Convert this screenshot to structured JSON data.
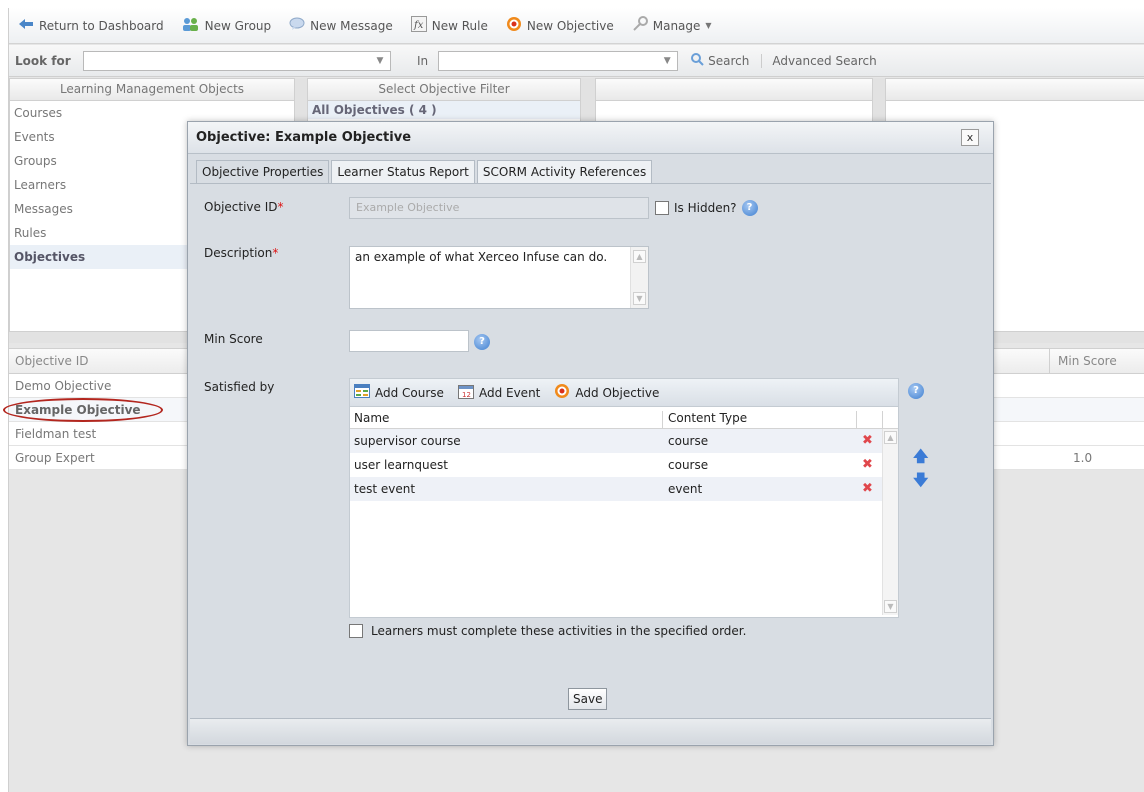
{
  "toolbar": {
    "return": "Return to Dashboard",
    "new_group": "New Group",
    "new_message": "New Message",
    "new_rule": "New Rule",
    "new_objective": "New Objective",
    "manage": "Manage"
  },
  "searchbar": {
    "look_for_label": "Look for",
    "in_label": "In",
    "search": "Search",
    "advanced": "Advanced Search"
  },
  "panels": {
    "lmo_title": "Learning Management Objects",
    "lmo_items": [
      "Courses",
      "Events",
      "Groups",
      "Learners",
      "Messages",
      "Rules",
      "Objectives"
    ],
    "filter_title": "Select Objective Filter",
    "filter_item": "All Objectives ( 4 )"
  },
  "grid": {
    "col_id": "Objective ID",
    "col_min": "Min Score",
    "rows": [
      {
        "id": "Demo Objective",
        "min": ""
      },
      {
        "id": "Example Objective",
        "min": ""
      },
      {
        "id": "Fieldman test",
        "min": ""
      },
      {
        "id": "Group Expert",
        "min": "1.0"
      }
    ]
  },
  "modal": {
    "title": "Objective: Example Objective",
    "close": "x",
    "tabs": [
      "Objective Properties",
      "Learner Status Report",
      "SCORM Activity References"
    ],
    "objective_id_label": "Objective ID",
    "objective_id_value": "Example Objective",
    "is_hidden_label": "Is Hidden?",
    "description_label": "Description",
    "description_value": "an example of what Xerceo Infuse can do.",
    "min_score_label": "Min Score",
    "satisfied_by_label": "Satisfied by",
    "add_course": "Add Course",
    "add_event": "Add Event",
    "add_objective": "Add Objective",
    "col_name": "Name",
    "col_type": "Content Type",
    "activities": [
      {
        "name": "supervisor course",
        "type": "course"
      },
      {
        "name": "user learnquest",
        "type": "course"
      },
      {
        "name": "test event",
        "type": "event"
      }
    ],
    "order_label": "Learners must complete these activities in the specified order.",
    "save": "Save"
  }
}
